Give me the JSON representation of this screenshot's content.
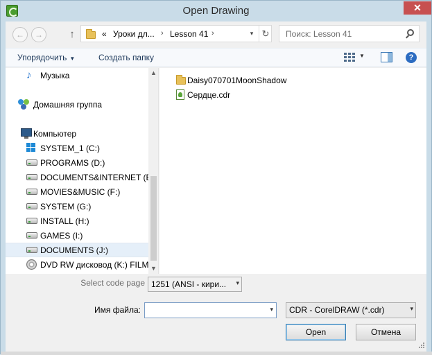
{
  "window": {
    "title": "Open Drawing",
    "close_glyph": "✕"
  },
  "address_bar": {
    "overflow_glyph": "«",
    "segments": [
      "Уроки дл...",
      "Lesson 41"
    ],
    "separator_glyph": "›",
    "dropdown_glyph": "▾",
    "refresh_glyph": "↻"
  },
  "nav_buttons": {
    "back_glyph": "←",
    "forward_glyph": "→",
    "up_glyph": "↑"
  },
  "search": {
    "placeholder": "Поиск: Lesson 41"
  },
  "toolbar": {
    "organize_label": "Упорядочить",
    "organize_arrow": "▼",
    "new_folder_label": "Создать папку",
    "views_arrow": "▼",
    "help_glyph": "?"
  },
  "nav_pane": {
    "items": [
      {
        "label": "Музыка",
        "icon": "music-icon"
      },
      {
        "label": "Домашняя группа",
        "icon": "homegroup-icon"
      },
      {
        "label": "Компьютер",
        "icon": "computer-icon"
      },
      {
        "label": "SYSTEM_1 (C:)",
        "icon": "windows-drive-icon"
      },
      {
        "label": "PROGRAMS (D:)",
        "icon": "drive-icon"
      },
      {
        "label": "DOCUMENTS&INTERNET (E:)",
        "icon": "drive-icon"
      },
      {
        "label": "MOVIES&MUSIC (F:)",
        "icon": "drive-icon"
      },
      {
        "label": "SYSTEM (G:)",
        "icon": "drive-icon"
      },
      {
        "label": "INSTALL (H:)",
        "icon": "drive-icon"
      },
      {
        "label": "GAMES (I:)",
        "icon": "drive-icon"
      },
      {
        "label": "DOCUMENTS (J:)",
        "icon": "drive-icon",
        "selected": true
      },
      {
        "label": "DVD RW дисковод (K:) FILMS",
        "icon": "disc-icon"
      }
    ],
    "scroll_up_glyph": "▲",
    "scroll_down_glyph": "▼"
  },
  "files": [
    {
      "name": "Daisy070701MoonShadow",
      "icon": "folder-icon"
    },
    {
      "name": "Сердце.cdr",
      "icon": "cdr-file-icon"
    }
  ],
  "bottom": {
    "code_page_label": "Select code page",
    "code_page_value": "1251  (ANSI - кири...",
    "filename_label": "Имя файла:",
    "filename_value": "",
    "filetype_value": "CDR - CorelDRAW (*.cdr)",
    "dropdown_glyph": "▾",
    "open_label": "Open",
    "cancel_label": "Отмена"
  },
  "colors": {
    "window_frame": "#c9dce8",
    "close_button": "#c75050",
    "selection": "#e5eff9",
    "toolbar_text": "#1e395b"
  }
}
